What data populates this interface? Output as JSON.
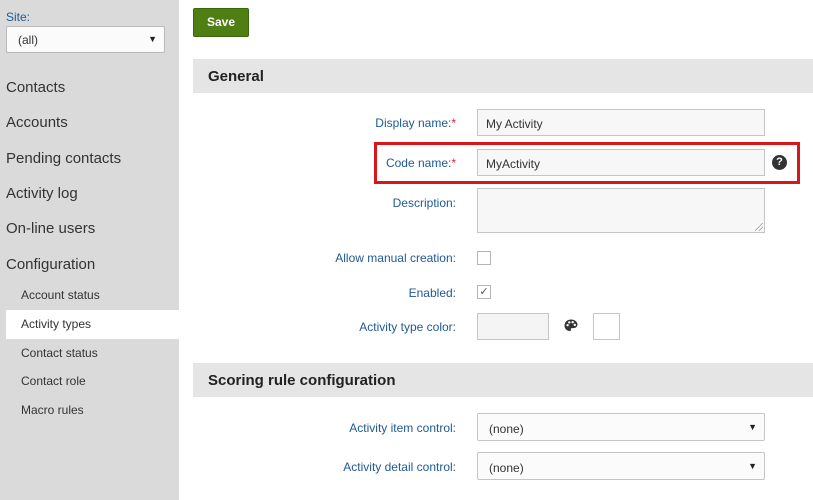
{
  "sidebar": {
    "site_label": "Site:",
    "site_value": "(all)",
    "nav": [
      "Contacts",
      "Accounts",
      "Pending contacts",
      "Activity log",
      "On-line users",
      "Configuration"
    ],
    "sub": [
      "Account status",
      "Activity types",
      "Contact status",
      "Contact role",
      "Macro rules"
    ],
    "active_sub": "Activity types"
  },
  "toolbar": {
    "save_label": "Save"
  },
  "general": {
    "title": "General",
    "display_name_label": "Display name:",
    "display_name_value": "My Activity",
    "code_name_label": "Code name:",
    "code_name_value": "MyActivity",
    "required_mark": "*",
    "description_label": "Description:",
    "allow_manual_label": "Allow manual creation:",
    "allow_manual_checked": false,
    "enabled_label": "Enabled:",
    "enabled_checked": true,
    "color_label": "Activity type color:"
  },
  "scoring": {
    "title": "Scoring rule configuration",
    "item_control_label": "Activity item control:",
    "item_control_value": "(none)",
    "detail_control_label": "Activity detail control:",
    "detail_control_value": "(none)"
  },
  "icons": {
    "help": "help-icon",
    "palette": "palette-icon",
    "check": "✓",
    "dropdown": "▼"
  },
  "colors": {
    "save_button": "#4f7f12",
    "link_label": "#1f5a93",
    "highlight": "#d9161b",
    "sidebar": "#d9dad9"
  }
}
